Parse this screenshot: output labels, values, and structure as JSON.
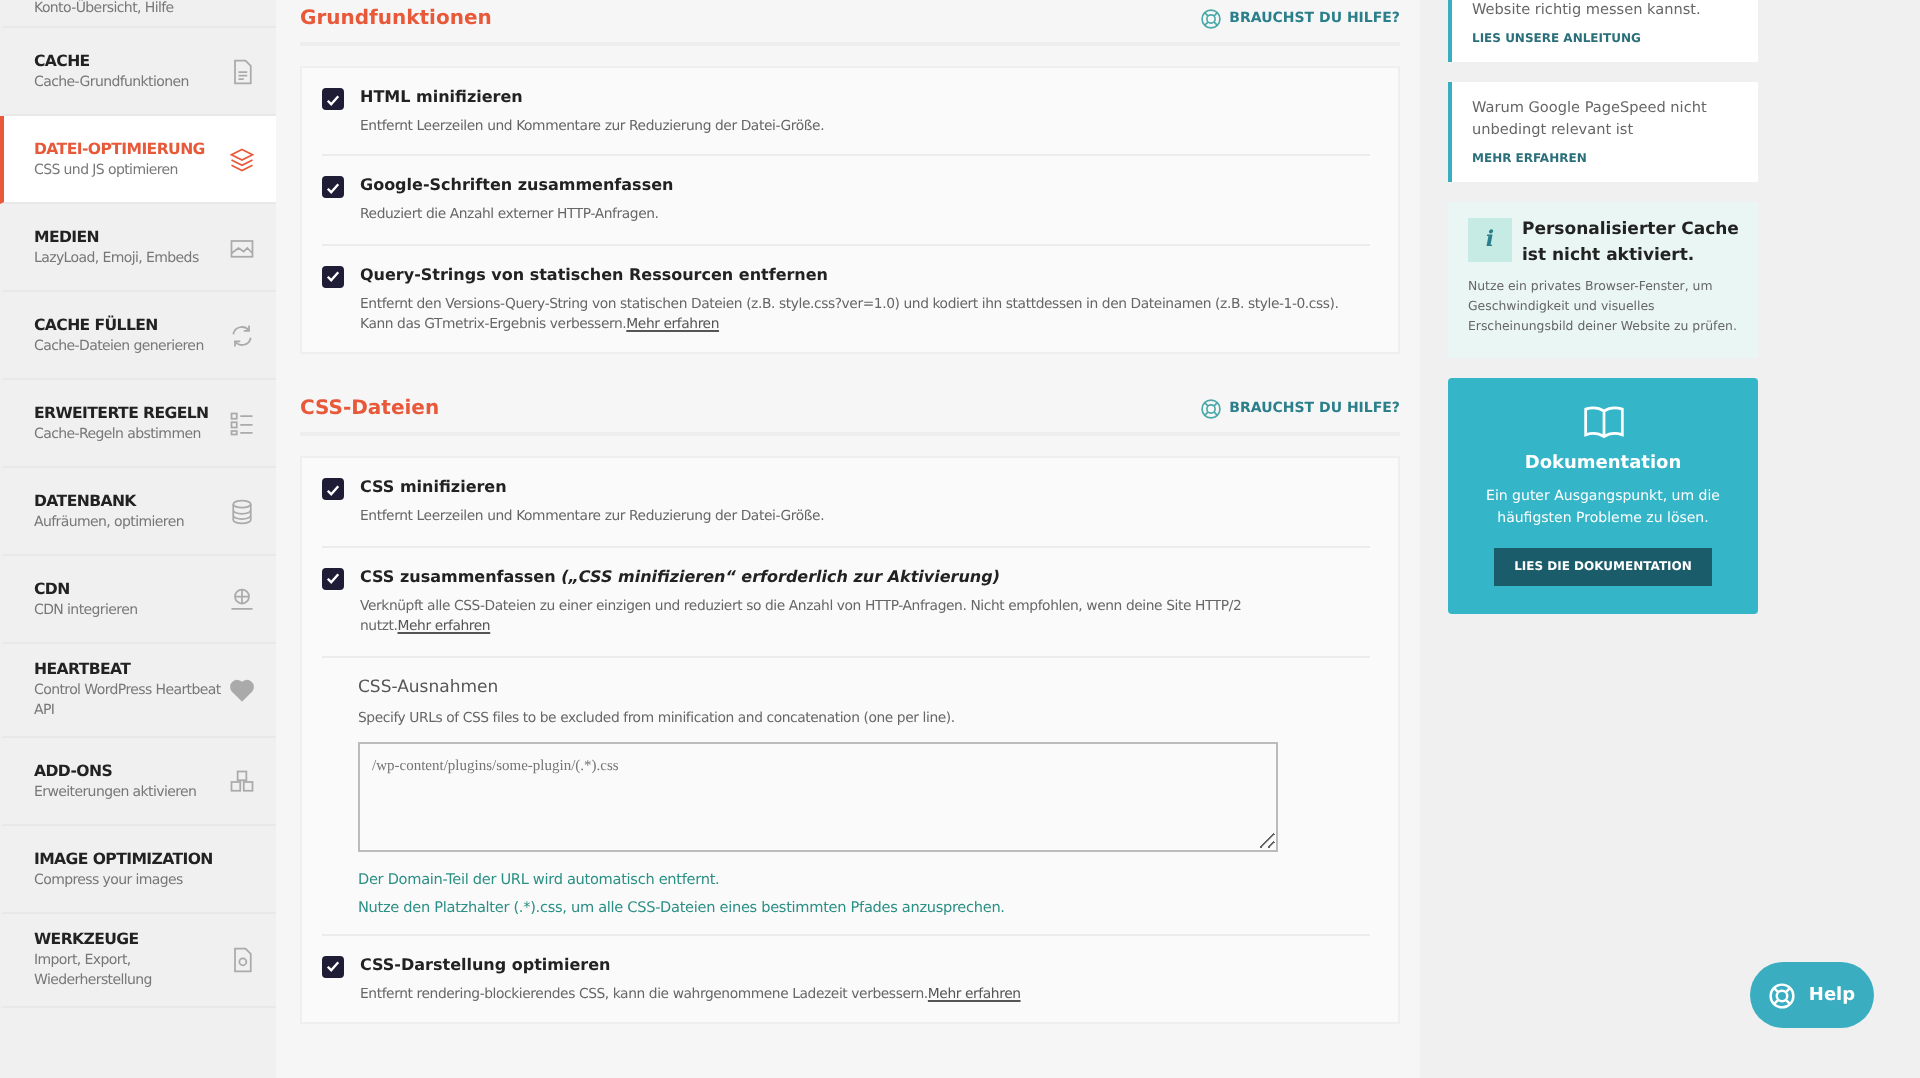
{
  "sidebar": {
    "items": [
      {
        "subtitle": "Konto-Übersicht, Hilfe",
        "selected": false
      },
      {
        "title": "CACHE",
        "subtitle": "Cache-Grundfunktionen",
        "selected": false
      },
      {
        "title": "DATEI-OPTIMIERUNG",
        "subtitle": "CSS und JS optimieren",
        "selected": true
      },
      {
        "title": "MEDIEN",
        "subtitle": "LazyLoad, Emoji, Embeds",
        "selected": false
      },
      {
        "title": "CACHE FÜLLEN",
        "subtitle": "Cache-Dateien generieren",
        "selected": false
      },
      {
        "title": "ERWEITERTE REGELN",
        "subtitle": "Cache-Regeln abstimmen",
        "selected": false
      },
      {
        "title": "DATENBANK",
        "subtitle": "Aufräumen, optimieren",
        "selected": false
      },
      {
        "title": "CDN",
        "subtitle": "CDN integrieren",
        "selected": false
      },
      {
        "title": "HEARTBEAT",
        "subtitle": "Control WordPress Heartbeat API",
        "selected": false
      },
      {
        "title": "ADD-ONS",
        "subtitle": "Erweiterungen aktivieren",
        "selected": false
      },
      {
        "title": "IMAGE OPTIMIZATION",
        "subtitle": "Compress your images",
        "selected": false
      },
      {
        "title": "WERKZEUGE",
        "subtitle": "Import, Export, Wiederherstellung",
        "selected": false
      }
    ]
  },
  "sections": [
    {
      "title": "Grundfunktionen",
      "help_link": "BRAUCHST DU HILFE?",
      "options": [
        {
          "kind": "checkbox",
          "label": "HTML minifizieren",
          "checked": true,
          "description": "Entfernt Leerzeilen und Kommentare zur Reduzierung der Datei-Größe."
        },
        {
          "kind": "checkbox",
          "label": "Google-Schriften zusammenfassen",
          "checked": true,
          "description": "Reduziert die Anzahl externer HTTP-Anfragen."
        },
        {
          "kind": "checkbox",
          "label": "Query-Strings von statischen Ressourcen entfernen",
          "checked": true,
          "description": "Entfernt den Versions-Query-String von statischen Dateien (z.B. style.css?ver=1.0) und kodiert ihn stattdessen in den Dateinamen (z.B. style-1-0.css). Kann das GTmetrix-Ergebnis verbessern.",
          "link": "Mehr erfahren"
        }
      ]
    },
    {
      "title": "CSS-Dateien",
      "help_link": "BRAUCHST DU HILFE?",
      "options": [
        {
          "kind": "checkbox",
          "label": "CSS minifizieren",
          "checked": true,
          "description": "Entfernt Leerzeilen und Kommentare zur Reduzierung der Datei-Größe."
        },
        {
          "kind": "checkbox",
          "label": "CSS zusammenfassen *(„CSS minifizieren“ erforderlich zur Aktivierung)*",
          "checked": true,
          "description": "Verknüpft alle CSS-Dateien zu einer einzigen und reduziert so die Anzahl von HTTP-Anfragen. Nicht empfohlen, wenn deine Site HTTP/2 nutzt.",
          "link": "Mehr erfahren"
        },
        {
          "kind": "textarea",
          "label": "CSS-Ausnahmen",
          "description": "Specify URLs of CSS files to be excluded from minification and concatenation (one per line).",
          "placeholder": "/wp-content/plugins/some-plugin/(.*).css",
          "hints": [
            "Der Domain-Teil der URL wird automatisch entfernt.",
            "Nutze den Platzhalter (.*).css, um alle CSS-Dateien eines bestimmten Pfades anzusprechen."
          ]
        },
        {
          "kind": "checkbox",
          "label": "CSS-Darstellung optimieren",
          "checked": true,
          "description": "Entfernt rendering-blockierendes CSS, kann die wahrgenommene Ladezeit verbessern.",
          "link": "Mehr erfahren"
        }
      ]
    }
  ],
  "aside": {
    "tips": [
      {
        "text": "Website richtig messen kannst.",
        "link": "LIES UNSERE ANLEITUNG"
      },
      {
        "text": "Warum Google PageSpeed nicht unbedingt relevant ist",
        "link": "MEHR ERFAHREN"
      }
    ],
    "notice": {
      "icon_text": "i",
      "title": "Personalisierter Cache ist nicht aktiviert.",
      "text": "Nutze ein privates Browser-Fenster, um Geschwindigkeit und visuelles Erscheinungsbild deiner Website zu prüfen."
    },
    "docs": {
      "title": "Dokumentation",
      "text": "Ein guter Ausgangspunkt, um die häufigsten Probleme zu lösen.",
      "button": "LIES DIE DOKUMENTATION"
    }
  },
  "help_button": {
    "label": "Help"
  }
}
